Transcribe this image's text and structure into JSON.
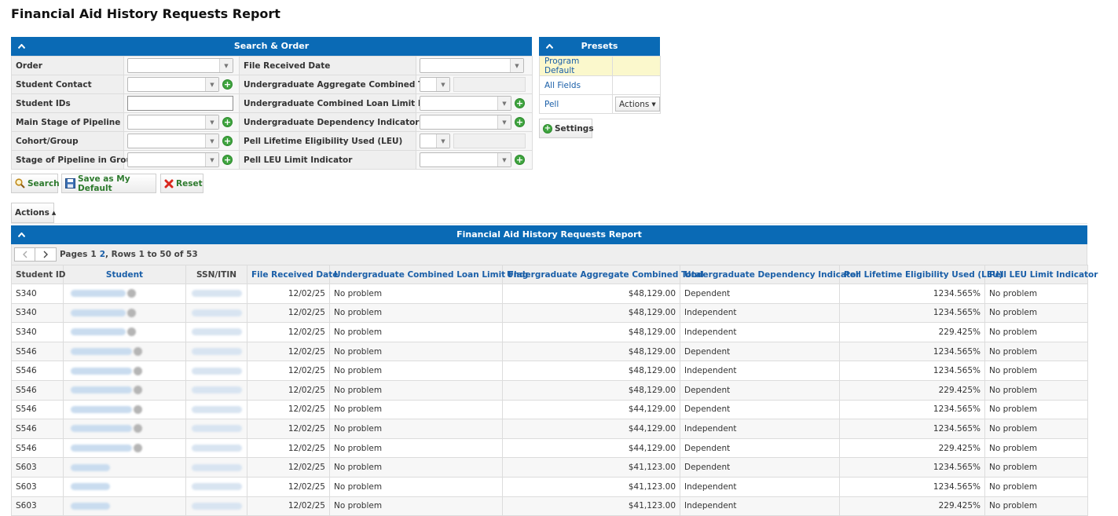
{
  "page_title": "Financial Aid History Requests Report",
  "search": {
    "header": "Search & Order",
    "rows": [
      {
        "left_label": "Order",
        "right_label": "File Received Date"
      },
      {
        "left_label": "Student Contact",
        "right_label": "Undergraduate Aggregate Combined Total"
      },
      {
        "left_label": "Student IDs",
        "right_label": "Undergraduate Combined Loan Limit Flag"
      },
      {
        "left_label": "Main Stage of Pipeline",
        "right_label": "Undergraduate Dependency Indicator"
      },
      {
        "left_label": "Cohort/Group",
        "right_label": "Pell Lifetime Eligibility Used (LEU)"
      },
      {
        "left_label": "Stage of Pipeline in Group",
        "right_label": "Pell LEU Limit Indicator"
      }
    ],
    "buttons": {
      "search": "Search",
      "save_default": "Save as My Default",
      "reset": "Reset"
    }
  },
  "presets": {
    "header": "Presets",
    "items": [
      "Program Default",
      "All Fields",
      "Pell"
    ],
    "actions_label": "Actions",
    "settings_label": "Settings"
  },
  "actions_label": "Actions",
  "report": {
    "header": "Financial Aid History Requests Report",
    "pager": {
      "prefix": "Pages",
      "page1": "1",
      "page2": "2",
      "rows_text": ", Rows 1 to 50 of 53"
    },
    "columns": [
      "Student ID",
      "Student",
      "SSN/ITIN",
      "File Received Date",
      "Undergraduate Combined Loan Limit Flag",
      "Undergraduate Aggregate Combined Total",
      "Undergraduate Dependency Indicator",
      "Pell Lifetime Eligibility Used (LEU)",
      "Pell LEU Limit Indicator"
    ],
    "rows": [
      {
        "id": "S340",
        "date": "12/02/25",
        "loan_flag": "No problem",
        "total": "$48,129.00",
        "dep": "Dependent",
        "leu": "1234.565%",
        "leu_limit": "No problem"
      },
      {
        "id": "S340",
        "date": "12/02/25",
        "loan_flag": "No problem",
        "total": "$48,129.00",
        "dep": "Independent",
        "leu": "1234.565%",
        "leu_limit": "No problem"
      },
      {
        "id": "S340",
        "date": "12/02/25",
        "loan_flag": "No problem",
        "total": "$48,129.00",
        "dep": "Independent",
        "leu": "229.425%",
        "leu_limit": "No problem"
      },
      {
        "id": "S546",
        "date": "12/02/25",
        "loan_flag": "No problem",
        "total": "$48,129.00",
        "dep": "Dependent",
        "leu": "1234.565%",
        "leu_limit": "No problem"
      },
      {
        "id": "S546",
        "date": "12/02/25",
        "loan_flag": "No problem",
        "total": "$48,129.00",
        "dep": "Independent",
        "leu": "1234.565%",
        "leu_limit": "No problem"
      },
      {
        "id": "S546",
        "date": "12/02/25",
        "loan_flag": "No problem",
        "total": "$48,129.00",
        "dep": "Dependent",
        "leu": "229.425%",
        "leu_limit": "No problem"
      },
      {
        "id": "S546",
        "date": "12/02/25",
        "loan_flag": "No problem",
        "total": "$44,129.00",
        "dep": "Dependent",
        "leu": "1234.565%",
        "leu_limit": "No problem"
      },
      {
        "id": "S546",
        "date": "12/02/25",
        "loan_flag": "No problem",
        "total": "$44,129.00",
        "dep": "Independent",
        "leu": "1234.565%",
        "leu_limit": "No problem"
      },
      {
        "id": "S546",
        "date": "12/02/25",
        "loan_flag": "No problem",
        "total": "$44,129.00",
        "dep": "Dependent",
        "leu": "229.425%",
        "leu_limit": "No problem"
      },
      {
        "id": "S603",
        "date": "12/02/25",
        "loan_flag": "No problem",
        "total": "$41,123.00",
        "dep": "Dependent",
        "leu": "1234.565%",
        "leu_limit": "No problem"
      },
      {
        "id": "S603",
        "date": "12/02/25",
        "loan_flag": "No problem",
        "total": "$41,123.00",
        "dep": "Independent",
        "leu": "1234.565%",
        "leu_limit": "No problem"
      },
      {
        "id": "S603",
        "date": "12/02/25",
        "loan_flag": "No problem",
        "total": "$41,123.00",
        "dep": "Independent",
        "leu": "229.425%",
        "leu_limit": "No problem"
      }
    ]
  }
}
